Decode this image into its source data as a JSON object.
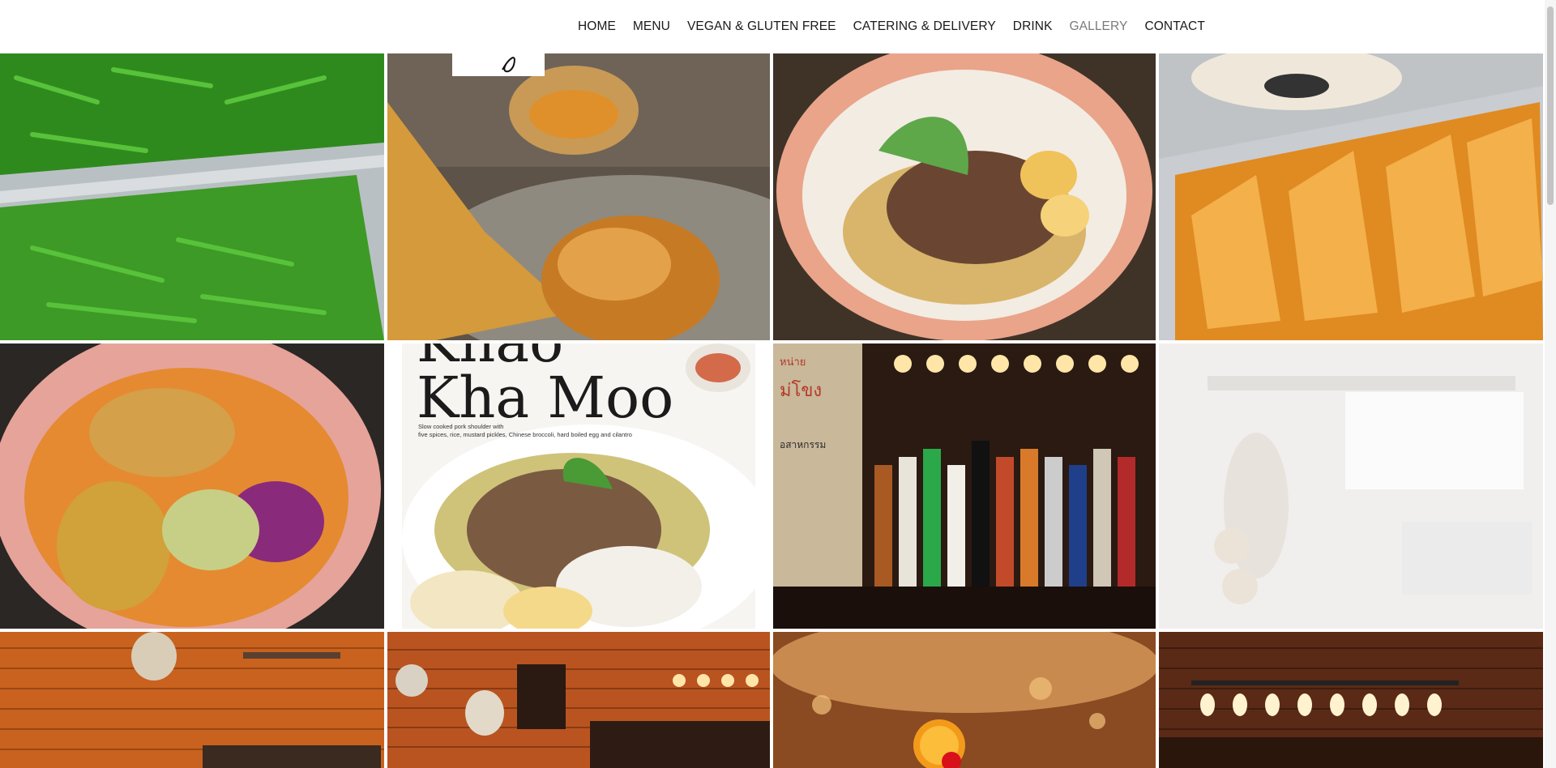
{
  "nav": {
    "items": [
      {
        "label": "HOME"
      },
      {
        "label": "MENU"
      },
      {
        "label": "VEGAN & GLUTEN FREE"
      },
      {
        "label": "CATERING & DELIVERY"
      },
      {
        "label": "DRINK"
      },
      {
        "label": "GALLERY"
      },
      {
        "label": "CONTACT"
      }
    ],
    "active": "GALLERY",
    "active_color": "#7a7a7a",
    "text_color": "#1a1a1a"
  },
  "gallery": {
    "poster": {
      "title_line1": "Khao",
      "title_line2": "Kha Moo",
      "subtitle_line1": "Slow cooked pork shoulder with",
      "subtitle_line2": "five spices, rice, mustard pickles, Chinese broccoli, hard boiled egg and cilantro"
    },
    "bar_sign": {
      "text_top": "หน่าย",
      "text_mid": "ม่โขง",
      "text_bottom": "อสาหกรรม"
    },
    "tiles": [
      {
        "subject": "green beans in foil trays"
      },
      {
        "subject": "chicken wing with sauce"
      },
      {
        "subject": "noodle bowl with egg and greens"
      },
      {
        "subject": "crispy fried rolls in foil tray"
      },
      {
        "subject": "khao soi curry noodle bowl"
      },
      {
        "subject": "Khao Kha Moo poster"
      },
      {
        "subject": "bar with liquor bottles"
      },
      {
        "subject": "faded kitchen interior"
      },
      {
        "subject": "brick wall interior"
      },
      {
        "subject": "brick wall bar with clock"
      },
      {
        "subject": "cocktail with orange and cherry"
      },
      {
        "subject": "bar with pendant lights"
      }
    ]
  }
}
